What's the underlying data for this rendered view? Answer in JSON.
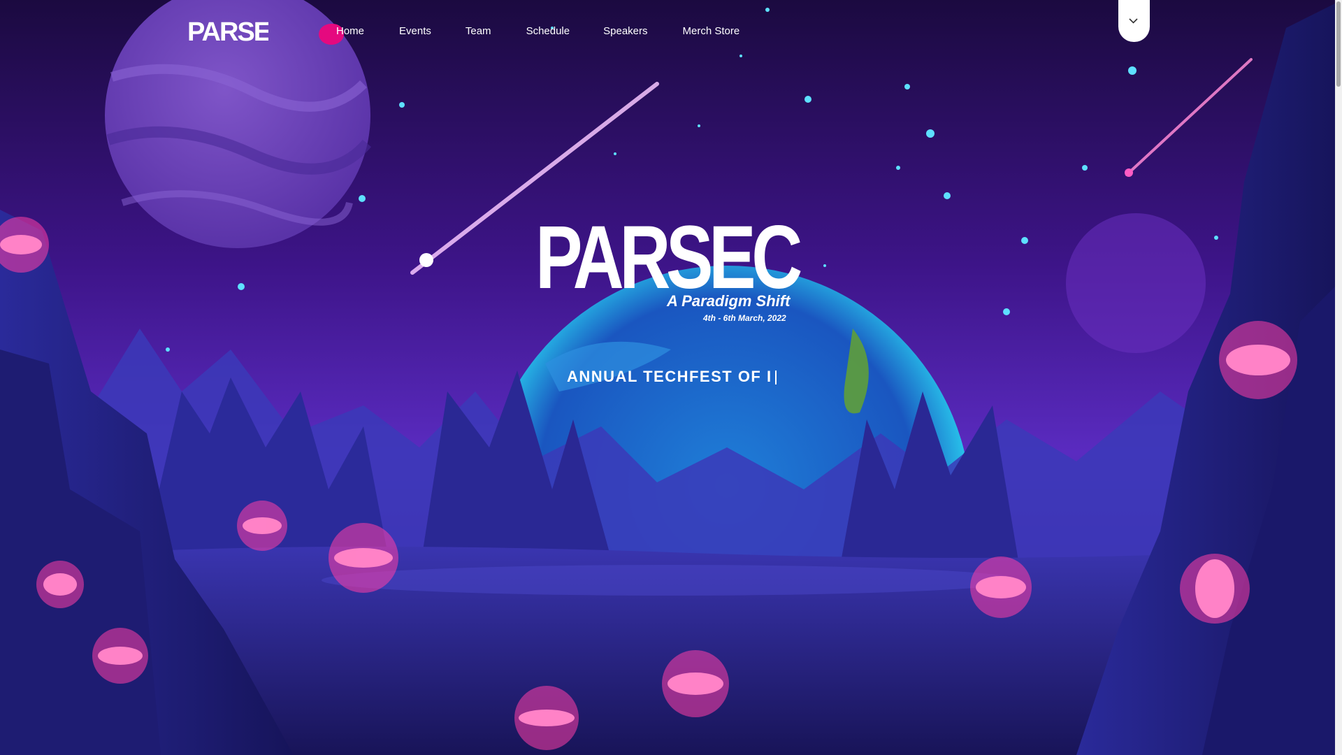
{
  "brand": {
    "logo_text": "PARSEC"
  },
  "nav": {
    "items": [
      {
        "label": "Home",
        "active": true
      },
      {
        "label": "Events"
      },
      {
        "label": "Team"
      },
      {
        "label": "Schedule"
      },
      {
        "label": "Speakers"
      },
      {
        "label": "Merch Store"
      }
    ]
  },
  "hero": {
    "logo_text": "PARSEC",
    "subtitle": "A Paradigm Shift",
    "date": "4th - 6th March, 2022",
    "typing_text": "ANNUAL TECHFEST OF I"
  },
  "icons": {
    "dropdown": "chevron-down-icon"
  },
  "colors": {
    "accent": "#e5097f",
    "sky_top": "#1b0a40",
    "sky_mid": "#5a1fb0",
    "planet": "#2ab0e8",
    "glow": "#ff3ea5"
  }
}
